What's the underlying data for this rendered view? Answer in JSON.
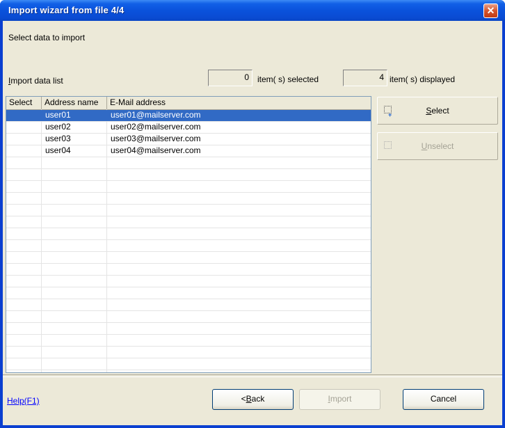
{
  "window": {
    "title": "Import wizard from file 4/4"
  },
  "header": {
    "instruction": "Select data to import"
  },
  "summary": {
    "list_label": "Import data list",
    "selected_count": "0",
    "selected_label": "item( s) selected",
    "displayed_count": "4",
    "displayed_label": "item( s) displayed"
  },
  "table": {
    "columns": [
      "Select",
      "Address name",
      "E-Mail address"
    ],
    "rows": [
      {
        "select": "",
        "name": "user01",
        "email": "user01@mailserver.com",
        "selected": true
      },
      {
        "select": "",
        "name": "user02",
        "email": "user02@mailserver.com",
        "selected": false
      },
      {
        "select": "",
        "name": "user03",
        "email": "user03@mailserver.com",
        "selected": false
      },
      {
        "select": "",
        "name": "user04",
        "email": "user04@mailserver.com",
        "selected": false
      }
    ]
  },
  "side_buttons": {
    "select_label": "Select",
    "unselect_label": "Unselect"
  },
  "footer": {
    "help_label": "Help(F1)",
    "back_label": "<Back",
    "import_label": "Import",
    "cancel_label": "Cancel"
  },
  "colors": {
    "titlebar": "#0a52dc",
    "selection": "#316ac5",
    "face": "#ece9d8",
    "link": "#0000ff"
  }
}
